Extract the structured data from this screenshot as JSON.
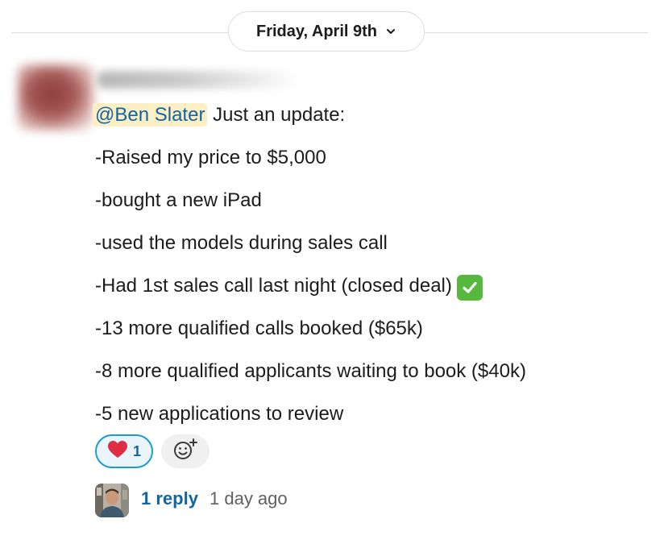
{
  "divider": {
    "date_label": "Friday, April 9th",
    "chevron_icon": "chevron-down-icon"
  },
  "message": {
    "mention": "@Ben Slater",
    "intro": " Just an update:",
    "lines": [
      "-Raised my price to $5,000",
      "-bought a new iPad",
      "-used the models during sales call",
      "-Had 1st sales call last night (closed deal)",
      "-13 more qualified calls booked ($65k)",
      "-8 more qualified applicants waiting to book ($40k)",
      "-5 new applications to review"
    ],
    "check_icon": "check-mark-button-icon"
  },
  "reactions": [
    {
      "emoji_icon": "red-heart-icon",
      "count": "1"
    }
  ],
  "add_reaction_icon": "add-reaction-icon",
  "thread": {
    "reply_count_label": "1 reply",
    "last_reply_time": "1 day ago"
  },
  "colors": {
    "mention_bg": "#fcefc4",
    "link": "#1264a3",
    "reaction_border": "#1d9bd1",
    "check_green": "#57b83e"
  }
}
